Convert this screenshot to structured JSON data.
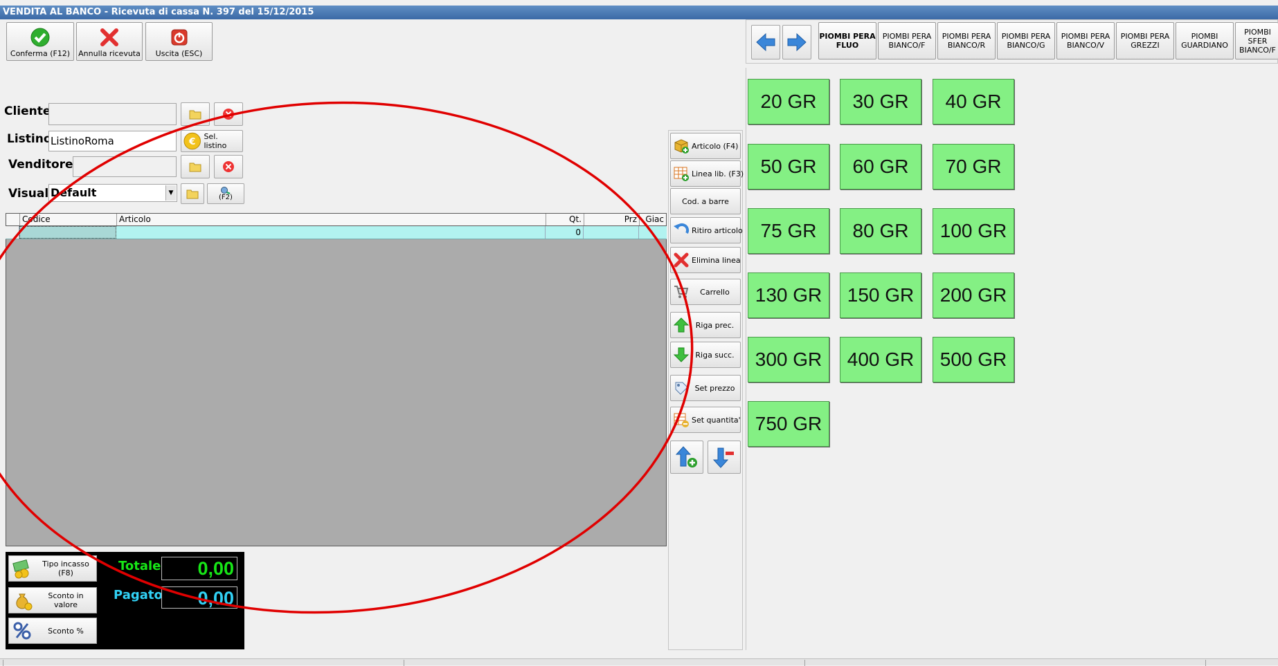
{
  "window": {
    "title": "VENDITA AL BANCO - Ricevuta di cassa N. 397 del 15/12/2015"
  },
  "toolbar": {
    "confirm_label": "Conferma (F12)",
    "cancel_label": "Annulla ricevuta",
    "exit_label": "Uscita (ESC)"
  },
  "form": {
    "cliente_label": "Cliente",
    "cliente_value": "",
    "listino_label": "Listino",
    "listino_value": "ListinoRoma",
    "sel_listino_label": "Sel. listino",
    "venditore_label": "Venditore",
    "venditore_value": "",
    "visual_label": "Visual.",
    "visual_value": "Default",
    "f2_label": "(F2)"
  },
  "grid": {
    "columns": [
      "Codice",
      "Articolo",
      "Qt.",
      "Prz",
      "Giac"
    ],
    "rows": [
      {
        "codice": "",
        "articolo": "",
        "qt": "0",
        "prz": "",
        "giac": ""
      }
    ]
  },
  "side_actions": [
    {
      "label": "Articolo (F4)",
      "icon": "box-add-icon"
    },
    {
      "label": "Linea lib. (F3)",
      "icon": "grid-add-icon"
    },
    {
      "label": "Cod. a barre",
      "icon": ""
    },
    {
      "label": "Ritiro articolo",
      "icon": "undo-icon"
    },
    {
      "label": "Elimina linea",
      "icon": "delete-icon"
    },
    {
      "label": "Carrello",
      "icon": "cart-icon"
    },
    {
      "label": "Riga prec.",
      "icon": "arrow-up-icon"
    },
    {
      "label": "Riga succ.",
      "icon": "arrow-down-icon"
    },
    {
      "label": "Set prezzo",
      "icon": "price-icon"
    },
    {
      "label": "Set quantita'",
      "icon": "quantity-icon"
    }
  ],
  "categories": [
    "PIOMBI PERA\nFLUO",
    "PIOMBI PERA\nBIANCO/F",
    "PIOMBI PERA\nBIANCO/R",
    "PIOMBI PERA\nBIANCO/G",
    "PIOMBI PERA\nBIANCO/V",
    "PIOMBI PERA\nGREZZI",
    "PIOMBI\nGUARDIANO",
    "PIOMBI SFER\nBIANCO/F"
  ],
  "weights": [
    "20 GR",
    "30 GR",
    "40 GR",
    "50 GR",
    "60 GR",
    "70 GR",
    "75 GR",
    "80 GR",
    "100 GR",
    "130 GR",
    "150 GR",
    "200 GR",
    "300 GR",
    "400 GR",
    "500 GR",
    "750 GR"
  ],
  "payment": {
    "tipo_incasso_label": "Tipo incasso (F8)",
    "sconto_valore_label": "Sconto in valore",
    "sconto_perc_label": "Sconto %",
    "totale_label": "Totale",
    "totale_value": "0,00",
    "pagato_label": "Pagato",
    "pagato_value": "0,00"
  },
  "colors": {
    "title_bar": "#4a7ab6",
    "weight_button": "#84f084",
    "total_green": "#17e617",
    "paid_cyan": "#31d1f5",
    "grid_row": "#b2f3f0",
    "annotation": "#e00000"
  }
}
